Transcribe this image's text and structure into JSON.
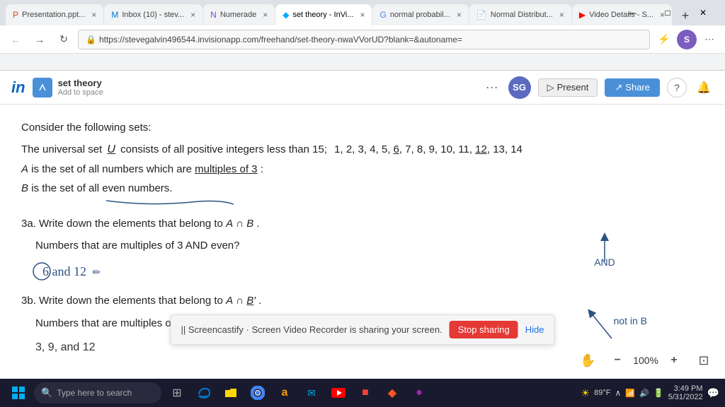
{
  "tabs": [
    {
      "label": "Presentation.ppt...",
      "active": false,
      "icon": "ppt"
    },
    {
      "label": "Inbox (10) - stev...",
      "active": false,
      "icon": "mail"
    },
    {
      "label": "Numerade",
      "active": false,
      "icon": "numerade"
    },
    {
      "label": "set theory - InVi...",
      "active": true,
      "icon": "invision"
    },
    {
      "label": "normal probabil...",
      "active": false,
      "icon": "google"
    },
    {
      "label": "Normal Distribut...",
      "active": false,
      "icon": "doc"
    },
    {
      "label": "Video Details - S...",
      "active": false,
      "icon": "video"
    }
  ],
  "address_bar": "https://stevegalvin496544.invisionapp.com/freehand/set-theory-nwaVVorUD?blank=&autoname=",
  "app": {
    "title": "set theory",
    "subtitle": "Add to space",
    "avatar": "SG"
  },
  "header_buttons": {
    "present": "Present",
    "share": "Share"
  },
  "content": {
    "consider": "Consider the following sets:",
    "universal": "The universal set",
    "U": "U",
    "universal_rest": "consists of all positive integers less than 15;",
    "numbers": "1, 2, 3, 4, 5, 6, 7, 8, 9, 10, 11, 12, 13, 14",
    "set_A": "A is the set of all numbers which are multiples of 3:",
    "set_B": "B is the set of all even numbers.",
    "q3a": "3a. Write down the elements that belong to A ∩ B.",
    "q3a_desc": "Numbers that are multiples of 3 AND even?",
    "q3a_annotation": "AND",
    "q3a_answer": "6 and 12",
    "q3b": "3b. Write down the elements that belong to A ∩ B′.",
    "q3b_desc": "Numbers that are multiples of 3 AND NOT even?",
    "q3b_annotation": "not in B",
    "q3b_answer": "3, 9, and 12"
  },
  "screencastify": {
    "message": "|| Screencastify · Screen Video Recorder is sharing your screen.",
    "stop": "Stop sharing",
    "hide": "Hide"
  },
  "bottom_bar": {
    "zoom": "100%"
  },
  "taskbar": {
    "search_placeholder": "Type here to search",
    "time": "3:49 PM",
    "date": "5/31/2022",
    "temp": "89°F"
  }
}
